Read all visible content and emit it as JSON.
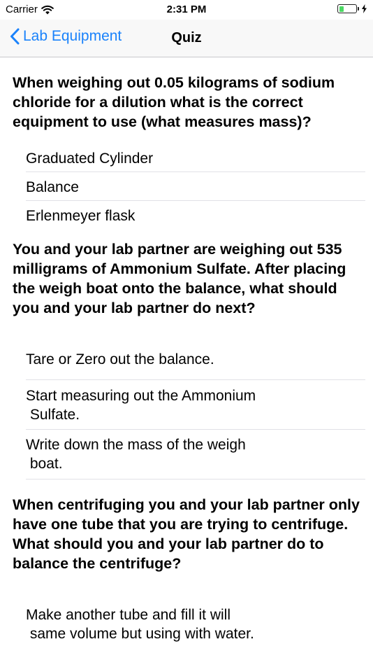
{
  "status_bar": {
    "carrier": "Carrier",
    "time": "2:31 PM",
    "battery_level": 0.3,
    "battery_color": "#4cd964"
  },
  "nav": {
    "back_label": "Lab Equipment",
    "title": "Quiz",
    "accent_color": "#1a82fb"
  },
  "questions": [
    {
      "text": "When weighing out 0.05 kilograms of sodium chloride for a dilution what is the correct equipment to use (what measures mass)?",
      "answers": [
        "Graduated Cylinder",
        "Balance",
        "Erlenmeyer flask"
      ]
    },
    {
      "text": "You and your lab partner are weighing out 535 milligrams of Ammonium Sulfate. After placing the weigh boat onto the balance, what should you and your lab partner do next?",
      "answers": [
        "Tare or Zero out the balance.",
        "Start measuring out the Ammonium\n Sulfate.",
        "Write down the mass of the weigh\n boat."
      ]
    },
    {
      "text": "When centrifuging you and your lab partner only have one tube that you are trying to centrifuge. What should you and your lab partner do to balance the centrifuge?",
      "answers": [
        "Make another tube and fill it will\n same volume but using with water."
      ]
    }
  ]
}
